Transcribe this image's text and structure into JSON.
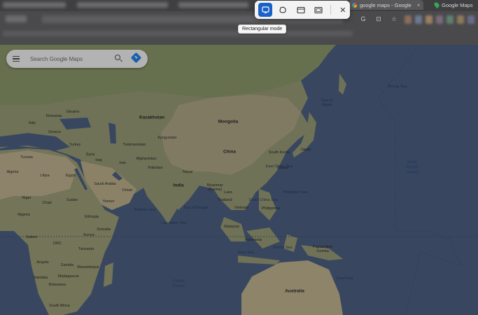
{
  "browser": {
    "tabs": [
      {
        "title": "google maps - Google",
        "close": "×"
      },
      {
        "title": "Google Maps"
      }
    ],
    "address_icons": [
      "G",
      "⊡",
      "☆"
    ]
  },
  "snip_toolbar": {
    "modes": [
      {
        "icon": "rectangle-mode-icon",
        "active": true
      },
      {
        "icon": "freeform-mode-icon",
        "active": false
      },
      {
        "icon": "window-mode-icon",
        "active": false
      },
      {
        "icon": "fullscreen-mode-icon",
        "active": false
      }
    ],
    "close": "✕",
    "tooltip": "Rectangular mode"
  },
  "maps": {
    "search_placeholder": "Search Google Maps",
    "accent": "#1a73e8",
    "labels": {
      "kazakhstan": "Kazakhstan",
      "mongolia": "Mongolia",
      "china": "China",
      "kyrgyzstan": "Kyrgyzstan",
      "turkmenistan": "Turkmenistan",
      "afghanistan": "Afghanistan",
      "pakistan": "Pakistan",
      "nepal": "Nepal",
      "india": "India",
      "myanmar": "Myanmar\n(Burma)",
      "laos": "Laos",
      "thailand": "Thailand",
      "vietnam": "Vietnam",
      "philippines": "Philippines",
      "malaysia": "Malaysia",
      "indonesia": "Indonesia",
      "png": "Papua New\nGuinea",
      "australia": "Australia",
      "south_korea": "South Korea",
      "japan": "Japan",
      "taiwan": "Taiwan",
      "romania": "Romania",
      "ukraine": "Ukraine",
      "italy": "Italy",
      "greece": "Greece",
      "turkey": "Turkey",
      "syria": "Syria",
      "iraq": "Iraq",
      "iran": "Iran",
      "tunisia": "Tunisia",
      "algeria": "Algeria",
      "libya": "Libya",
      "egypt": "Egypt",
      "saudi_arabia": "Saudi Arabia",
      "oman": "Oman",
      "yemen": "Yemen",
      "niger": "Niger",
      "chad": "Chad",
      "sudan": "Sudan",
      "nigeria": "Nigeria",
      "ethiopia": "Ethiopia",
      "somalia": "Somalia",
      "kenya": "Kenya",
      "gabon": "Gabon",
      "drc": "DRC",
      "tanzania": "Tanzania",
      "angola": "Angola",
      "zambia": "Zambia",
      "namibia": "Namibia",
      "botswana": "Botswana",
      "mozambique": "Mozambique",
      "madagascar": "Madagascar",
      "south_africa": "South Africa",
      "north_pacific": "North\nPacific\nOcean",
      "indian_ocean": "Indian\nOcean",
      "bering_sea": "Bering Sea",
      "sea_of_japan": "Sea of\nJapan",
      "east_china_sea": "East China Sea",
      "south_china_sea": "South China Sea",
      "bay_of_bengal": "Bay of Bengal",
      "arabian_sea": "Arabian Sea",
      "philippine_sea": "Philippine Sea",
      "coral_sea": "Coral Sea",
      "laccadive_sea": "Laccadive Sea",
      "banda_sea": "Banda Sea",
      "java_sea": "Java Sea"
    }
  }
}
